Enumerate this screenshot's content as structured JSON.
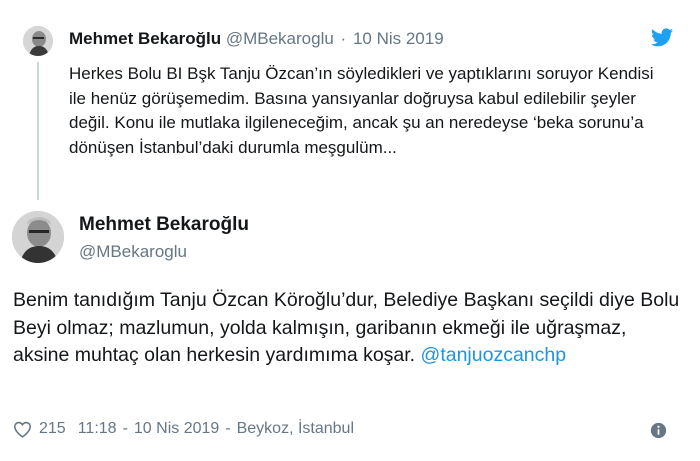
{
  "quoted_tweet": {
    "author_name": "Mehmet Bekaroğlu",
    "author_handle": "@MBekaroglu",
    "separator": "·",
    "date": "10 Nis 2019",
    "text": "Herkes Bolu BI Bşk Tanju Özcan’ın söyledikleri ve yaptıklarını soruyor Kendisi ile henüz görüşemedim. Basına yansıyanlar doğruysa kabul edilebilir şeyler değil. Konu ile mutlaka ilgileneceğim, ancak şu an neredeyse ‘beka sorunu’a dönüşen İstanbul’daki durumla meşgulüm..."
  },
  "main_tweet": {
    "author_name": "Mehmet Bekaroğlu",
    "author_handle": "@MBekaroglu",
    "text": "Benim tanıdığım Tanju Özcan Köroğlu’dur, Belediye Başkanı seçildi diye Bolu Beyi olmaz; mazlumun, yolda kalmışın, garibanın ekmeği ile uğraşmaz, aksine muhtaç olan herkesin yardımıma koşar. ",
    "mention": "@tanjuozcanchp",
    "likes": "215",
    "time": "11:18",
    "date": "10 Nis 2019",
    "location": "Beykoz, İstanbul",
    "footer_separator": "-"
  },
  "icons": {
    "brand": "twitter-bird-icon",
    "like": "heart-icon",
    "info": "info-icon"
  },
  "colors": {
    "text": "#14171a",
    "secondary": "#657786",
    "link": "#1b95e0",
    "brand": "#1da1f2",
    "thread_line": "#ccd6dd"
  }
}
